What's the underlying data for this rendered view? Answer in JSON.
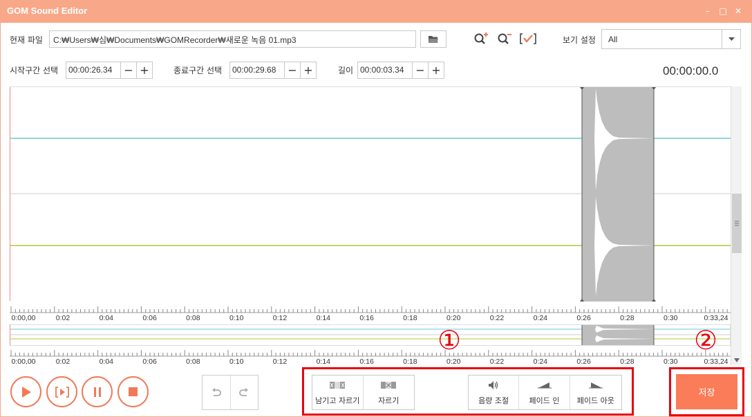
{
  "window": {
    "title": "GOM Sound Editor",
    "minimize": "–",
    "restore": "□",
    "close": "✕"
  },
  "file": {
    "label": "현재 파일",
    "path": "C:₩Users₩심₩Documents₩GOMRecorder₩새로운 녹음 01.mp3",
    "open_icon": "folder-icon"
  },
  "toolbar": {
    "zoom_in_icon": "zoom-in-icon",
    "zoom_out_icon": "zoom-out-icon",
    "select_icon": "check-bracket-icon",
    "view_label": "보기 설정",
    "view_value": "All"
  },
  "selection": {
    "start_label": "시작구간 선택",
    "start_value": "00:00:26.34",
    "end_label": "종료구간 선택",
    "end_value": "00:00:29.68",
    "length_label": "길이",
    "length_value": "00:00:03.34",
    "minus": "−",
    "plus": "+"
  },
  "current_time": "00:00:00.0",
  "ruler_labels": [
    "0:00,00",
    "0:02",
    "0:04",
    "0:06",
    "0:08",
    "0:10",
    "0:12",
    "0:14",
    "0:16",
    "0:18",
    "0:20",
    "0:22",
    "0:24",
    "0:26",
    "0:28",
    "0:30",
    "0:33,24"
  ],
  "colors": {
    "accent": "#fa7c58",
    "title_bar": "#f8a888",
    "channel_top": "#6cc8d8",
    "channel_bottom": "#a8c83a",
    "selection": "#bdbdbd",
    "highlight": "#e8000e"
  },
  "playback": {
    "play_icon": "play-icon",
    "play_selection_icon": "play-selection-icon",
    "pause_icon": "pause-icon",
    "stop_icon": "stop-icon"
  },
  "history": {
    "undo_icon": "undo-icon",
    "redo_icon": "redo-icon"
  },
  "edit_tools": {
    "trim_keep_label": "남기고 자르기",
    "cut_label": "자르기"
  },
  "effects": {
    "volume_label": "음량 조절",
    "fade_in_label": "페이드 인",
    "fade_out_label": "페이드 아웃"
  },
  "save_label": "저장",
  "annotations": {
    "marker1": "①",
    "marker2": "②"
  }
}
